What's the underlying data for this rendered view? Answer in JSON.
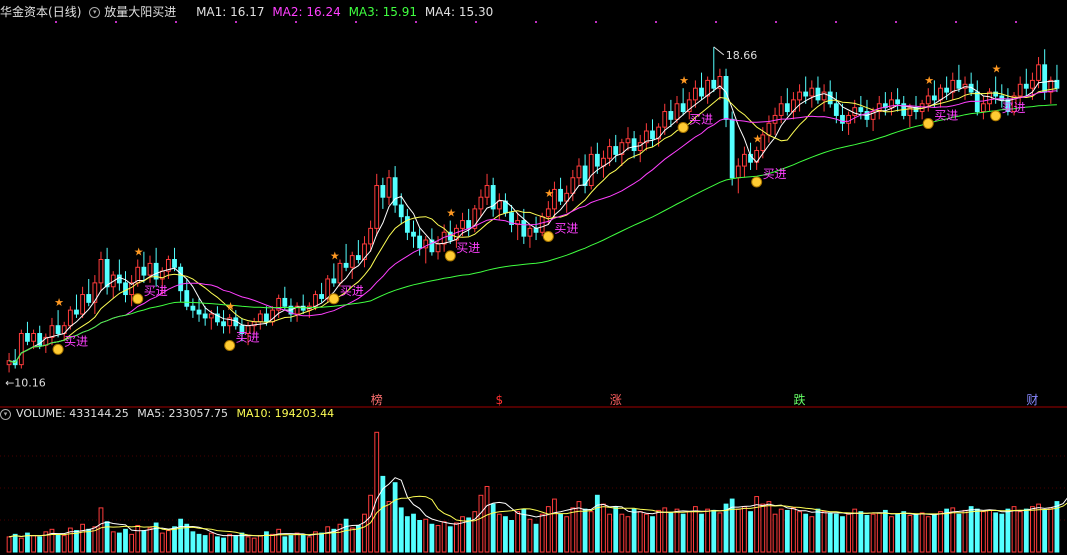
{
  "header": {
    "stock_name": "华金资本",
    "period": "(日线)",
    "indicator_name": "放量大阳买进",
    "ma1_label": "MA1: 16.17",
    "ma2_label": "MA2: 16.24",
    "ma3_label": "MA3: 15.91",
    "ma4_label": "MA4: 15.30"
  },
  "volume_header": {
    "volume_label": "VOLUME: 433144.25",
    "ma5_label": "MA5: 233057.75",
    "ma10_label": "MA10: 194203.44"
  },
  "colors": {
    "up": "#ff3c3c",
    "down": "#54ffff",
    "ma1": "#ffffff",
    "ma2": "#ffff55",
    "ma3": "#ff40ff",
    "ma4": "#40ff40",
    "buy_text": "#ff40ff"
  },
  "chart_data": {
    "type": "candlestick",
    "price_max_label": "18.66",
    "price_min_label": "10.16",
    "ylim": [
      9.9,
      19.3
    ],
    "buy_signal_text": "买进",
    "buy_signals": [
      8,
      21,
      36,
      53,
      72,
      88,
      110,
      122,
      150,
      161,
      178
    ],
    "event_markers": [
      {
        "index": 60,
        "text": "榜",
        "color": "#ff7070"
      },
      {
        "index": 80,
        "text": "$",
        "color": "#ff3030"
      },
      {
        "index": 99,
        "text": "涨",
        "color": "#ff6060"
      },
      {
        "index": 129,
        "text": "跌",
        "color": "#66ff66"
      },
      {
        "index": 167,
        "text": "财",
        "color": "#8888ff"
      }
    ],
    "candles": [
      [
        10.5,
        10.8,
        10.3,
        10.6
      ],
      [
        10.6,
        10.9,
        10.4,
        10.5
      ],
      [
        10.5,
        11.4,
        10.4,
        11.3
      ],
      [
        11.3,
        11.6,
        11.0,
        11.1
      ],
      [
        11.1,
        11.4,
        10.9,
        11.3
      ],
      [
        11.3,
        11.5,
        10.9,
        11.0
      ],
      [
        11.0,
        11.3,
        10.8,
        11.2
      ],
      [
        11.2,
        11.7,
        11.0,
        11.5
      ],
      [
        11.5,
        11.9,
        11.2,
        11.3
      ],
      [
        11.3,
        11.6,
        11.1,
        11.5
      ],
      [
        11.5,
        12.0,
        11.4,
        11.9
      ],
      [
        11.9,
        12.3,
        11.7,
        11.8
      ],
      [
        11.8,
        12.5,
        11.7,
        12.3
      ],
      [
        12.3,
        12.7,
        12.0,
        12.1
      ],
      [
        12.1,
        12.8,
        11.8,
        12.6
      ],
      [
        12.6,
        13.4,
        12.4,
        13.2
      ],
      [
        13.2,
        13.5,
        12.3,
        12.5
      ],
      [
        12.5,
        12.9,
        12.2,
        12.8
      ],
      [
        12.8,
        13.2,
        12.4,
        12.6
      ],
      [
        12.6,
        12.9,
        12.1,
        12.3
      ],
      [
        12.3,
        12.8,
        12.0,
        12.6
      ],
      [
        12.6,
        13.2,
        12.5,
        13.0
      ],
      [
        13.0,
        13.4,
        12.6,
        12.8
      ],
      [
        12.8,
        13.3,
        12.6,
        13.1
      ],
      [
        13.1,
        13.5,
        12.5,
        12.7
      ],
      [
        12.7,
        13.0,
        12.3,
        12.9
      ],
      [
        12.9,
        13.3,
        12.7,
        13.2
      ],
      [
        13.2,
        13.5,
        12.9,
        13.0
      ],
      [
        13.0,
        13.1,
        12.1,
        12.4
      ],
      [
        12.4,
        12.7,
        11.9,
        12.0
      ],
      [
        12.0,
        12.2,
        11.7,
        11.9
      ],
      [
        11.9,
        12.2,
        11.6,
        11.8
      ],
      [
        11.8,
        12.0,
        11.5,
        11.7
      ],
      [
        11.7,
        11.9,
        11.4,
        11.8
      ],
      [
        11.8,
        12.0,
        11.5,
        11.6
      ],
      [
        11.6,
        11.9,
        11.3,
        11.5
      ],
      [
        11.5,
        11.8,
        11.3,
        11.7
      ],
      [
        11.7,
        11.9,
        11.4,
        11.5
      ],
      [
        11.5,
        11.7,
        11.1,
        11.3
      ],
      [
        11.3,
        11.6,
        11.0,
        11.5
      ],
      [
        11.5,
        11.7,
        11.3,
        11.6
      ],
      [
        11.6,
        11.9,
        11.4,
        11.8
      ],
      [
        11.8,
        12.0,
        11.5,
        11.6
      ],
      [
        11.6,
        12.0,
        11.5,
        11.9
      ],
      [
        11.9,
        12.3,
        11.7,
        12.2
      ],
      [
        12.2,
        12.5,
        11.9,
        12.0
      ],
      [
        12.0,
        12.2,
        11.6,
        11.8
      ],
      [
        11.8,
        12.1,
        11.6,
        12.0
      ],
      [
        12.0,
        12.3,
        11.8,
        11.9
      ],
      [
        11.9,
        12.1,
        11.7,
        12.0
      ],
      [
        12.0,
        12.4,
        11.9,
        12.3
      ],
      [
        12.3,
        12.6,
        12.1,
        12.2
      ],
      [
        12.2,
        12.8,
        12.1,
        12.7
      ],
      [
        12.7,
        13.1,
        12.5,
        12.6
      ],
      [
        12.6,
        13.2,
        12.5,
        13.1
      ],
      [
        13.1,
        13.6,
        12.9,
        13.0
      ],
      [
        13.0,
        13.4,
        12.7,
        13.3
      ],
      [
        13.3,
        13.7,
        13.1,
        13.2
      ],
      [
        13.2,
        13.8,
        13.0,
        13.6
      ],
      [
        13.6,
        14.2,
        13.4,
        14.0
      ],
      [
        14.0,
        15.4,
        13.8,
        15.1
      ],
      [
        15.1,
        15.3,
        14.5,
        14.8
      ],
      [
        14.8,
        15.5,
        14.6,
        15.3
      ],
      [
        15.3,
        15.6,
        14.4,
        14.6
      ],
      [
        14.6,
        14.9,
        14.1,
        14.3
      ],
      [
        14.3,
        14.5,
        13.7,
        13.9
      ],
      [
        13.9,
        14.2,
        13.5,
        13.8
      ],
      [
        13.8,
        14.0,
        13.3,
        13.5
      ],
      [
        13.5,
        13.8,
        13.1,
        13.7
      ],
      [
        13.7,
        14.0,
        13.3,
        13.4
      ],
      [
        13.4,
        13.8,
        13.2,
        13.6
      ],
      [
        13.6,
        14.1,
        13.4,
        13.9
      ],
      [
        13.9,
        14.2,
        13.6,
        13.7
      ],
      [
        13.7,
        14.1,
        13.5,
        14.0
      ],
      [
        14.0,
        14.4,
        13.8,
        14.2
      ],
      [
        14.2,
        14.5,
        13.8,
        14.0
      ],
      [
        14.0,
        14.6,
        13.9,
        14.5
      ],
      [
        14.5,
        15.0,
        14.3,
        14.8
      ],
      [
        14.8,
        15.4,
        14.6,
        15.1
      ],
      [
        15.1,
        15.3,
        14.3,
        14.5
      ],
      [
        14.5,
        14.9,
        14.2,
        14.7
      ],
      [
        14.7,
        14.9,
        14.3,
        14.4
      ],
      [
        14.4,
        14.6,
        13.9,
        14.1
      ],
      [
        14.1,
        14.4,
        13.7,
        14.2
      ],
      [
        14.2,
        14.5,
        13.6,
        13.8
      ],
      [
        13.8,
        14.1,
        13.5,
        14.0
      ],
      [
        14.0,
        14.3,
        13.7,
        13.9
      ],
      [
        13.9,
        14.4,
        13.8,
        14.3
      ],
      [
        14.3,
        14.7,
        14.1,
        14.5
      ],
      [
        14.5,
        15.2,
        14.3,
        15.0
      ],
      [
        15.0,
        15.3,
        14.6,
        14.7
      ],
      [
        14.7,
        15.1,
        14.4,
        14.9
      ],
      [
        14.9,
        15.5,
        14.7,
        15.3
      ],
      [
        15.3,
        15.8,
        15.1,
        15.6
      ],
      [
        15.6,
        15.9,
        14.9,
        15.1
      ],
      [
        15.1,
        16.1,
        15.0,
        15.9
      ],
      [
        15.9,
        16.2,
        15.4,
        15.6
      ],
      [
        15.6,
        16.0,
        15.3,
        15.8
      ],
      [
        15.8,
        16.3,
        15.6,
        16.1
      ],
      [
        16.1,
        16.4,
        15.7,
        15.9
      ],
      [
        15.9,
        16.3,
        15.6,
        16.2
      ],
      [
        16.2,
        16.6,
        16.0,
        16.3
      ],
      [
        16.3,
        16.5,
        15.8,
        16.0
      ],
      [
        16.0,
        16.4,
        15.7,
        16.2
      ],
      [
        16.2,
        16.7,
        16.0,
        16.5
      ],
      [
        16.5,
        16.8,
        16.1,
        16.3
      ],
      [
        16.3,
        16.7,
        16.1,
        16.6
      ],
      [
        16.6,
        17.2,
        16.4,
        17.0
      ],
      [
        17.0,
        17.3,
        16.6,
        16.8
      ],
      [
        16.8,
        17.4,
        16.7,
        17.2
      ],
      [
        17.2,
        17.6,
        16.9,
        17.0
      ],
      [
        17.0,
        17.5,
        16.8,
        17.3
      ],
      [
        17.3,
        17.8,
        17.1,
        17.6
      ],
      [
        17.6,
        18.0,
        17.3,
        17.4
      ],
      [
        17.4,
        17.9,
        17.2,
        17.8
      ],
      [
        17.8,
        18.66,
        17.5,
        17.6
      ],
      [
        17.6,
        18.1,
        17.3,
        17.9
      ],
      [
        17.9,
        18.1,
        16.6,
        16.8
      ],
      [
        16.8,
        17.0,
        15.1,
        15.3
      ],
      [
        15.3,
        15.8,
        14.9,
        15.6
      ],
      [
        15.6,
        16.1,
        15.3,
        15.9
      ],
      [
        15.9,
        16.2,
        15.5,
        15.7
      ],
      [
        15.7,
        16.1,
        15.5,
        16.0
      ],
      [
        16.0,
        16.6,
        15.8,
        16.4
      ],
      [
        16.4,
        16.9,
        16.2,
        16.7
      ],
      [
        16.7,
        17.1,
        16.4,
        16.9
      ],
      [
        16.9,
        17.4,
        16.7,
        17.2
      ],
      [
        17.2,
        17.6,
        16.9,
        17.0
      ],
      [
        17.0,
        17.5,
        16.8,
        17.3
      ],
      [
        17.3,
        17.7,
        17.0,
        17.5
      ],
      [
        17.5,
        17.9,
        17.2,
        17.4
      ],
      [
        17.4,
        17.8,
        17.1,
        17.6
      ],
      [
        17.6,
        17.9,
        17.2,
        17.3
      ],
      [
        17.3,
        17.7,
        17.0,
        17.5
      ],
      [
        17.5,
        17.8,
        17.1,
        17.2
      ],
      [
        17.2,
        17.5,
        16.7,
        16.9
      ],
      [
        16.9,
        17.2,
        16.5,
        16.7
      ],
      [
        16.7,
        17.0,
        16.4,
        16.9
      ],
      [
        16.9,
        17.3,
        16.7,
        17.1
      ],
      [
        17.1,
        17.4,
        16.8,
        17.0
      ],
      [
        17.0,
        17.3,
        16.6,
        16.8
      ],
      [
        16.8,
        17.1,
        16.5,
        17.0
      ],
      [
        17.0,
        17.4,
        16.8,
        17.2
      ],
      [
        17.2,
        17.5,
        16.9,
        17.1
      ],
      [
        17.1,
        17.5,
        16.9,
        17.3
      ],
      [
        17.3,
        17.6,
        17.0,
        17.2
      ],
      [
        17.2,
        17.4,
        16.8,
        16.9
      ],
      [
        16.9,
        17.2,
        16.6,
        17.1
      ],
      [
        17.1,
        17.4,
        16.8,
        17.0
      ],
      [
        17.0,
        17.3,
        16.8,
        17.2
      ],
      [
        17.2,
        17.6,
        17.0,
        17.4
      ],
      [
        17.4,
        17.8,
        17.1,
        17.3
      ],
      [
        17.3,
        17.7,
        17.1,
        17.6
      ],
      [
        17.6,
        17.9,
        17.3,
        17.5
      ],
      [
        17.5,
        18.0,
        17.3,
        17.8
      ],
      [
        17.8,
        18.2,
        17.5,
        17.6
      ],
      [
        17.6,
        17.9,
        17.3,
        17.7
      ],
      [
        17.7,
        18.0,
        17.4,
        17.5
      ],
      [
        17.5,
        17.8,
        16.9,
        17.0
      ],
      [
        17.0,
        17.4,
        16.8,
        17.2
      ],
      [
        17.2,
        17.6,
        17.0,
        17.5
      ],
      [
        17.5,
        17.9,
        17.2,
        17.4
      ],
      [
        17.4,
        17.7,
        17.1,
        17.3
      ],
      [
        17.3,
        17.6,
        16.9,
        17.0
      ],
      [
        17.0,
        17.5,
        16.9,
        17.4
      ],
      [
        17.4,
        17.9,
        17.2,
        17.7
      ],
      [
        17.7,
        18.1,
        17.4,
        17.6
      ],
      [
        17.6,
        18.0,
        17.3,
        17.8
      ],
      [
        17.8,
        18.4,
        17.6,
        18.2
      ],
      [
        18.2,
        18.6,
        17.3,
        17.5
      ],
      [
        17.5,
        17.9,
        17.2,
        17.8
      ],
      [
        17.8,
        18.2,
        17.5,
        17.6
      ]
    ],
    "volumes": [
      12,
      14,
      11,
      15,
      13,
      12,
      16,
      18,
      14,
      13,
      19,
      17,
      22,
      18,
      20,
      35,
      24,
      16,
      15,
      18,
      14,
      21,
      17,
      19,
      23,
      15,
      17,
      20,
      26,
      22,
      16,
      14,
      13,
      15,
      12,
      11,
      14,
      13,
      15,
      12,
      11,
      13,
      16,
      14,
      18,
      12,
      13,
      15,
      14,
      12,
      16,
      15,
      20,
      18,
      22,
      26,
      19,
      21,
      30,
      45,
      95,
      60,
      40,
      55,
      35,
      28,
      30,
      25,
      26,
      22,
      21,
      24,
      20,
      23,
      28,
      27,
      32,
      45,
      52,
      38,
      30,
      28,
      25,
      32,
      34,
      26,
      22,
      30,
      36,
      42,
      30,
      28,
      35,
      40,
      34,
      32,
      45,
      38,
      30,
      36,
      30,
      28,
      34,
      32,
      30,
      28,
      33,
      35,
      31,
      34,
      30,
      32,
      36,
      30,
      34,
      33,
      31,
      38,
      42,
      34,
      36,
      32,
      44,
      38,
      40,
      30,
      34,
      33,
      35,
      32,
      30,
      28,
      34,
      32,
      31,
      30,
      28,
      30,
      34,
      32,
      29,
      30,
      31,
      33,
      28,
      30,
      32,
      29,
      30,
      31,
      28,
      30,
      32,
      34,
      35,
      30,
      33,
      36,
      34,
      32,
      33,
      31,
      30,
      34,
      36,
      32,
      34,
      36,
      38,
      33,
      35,
      40,
      46,
      70,
      100
    ]
  }
}
